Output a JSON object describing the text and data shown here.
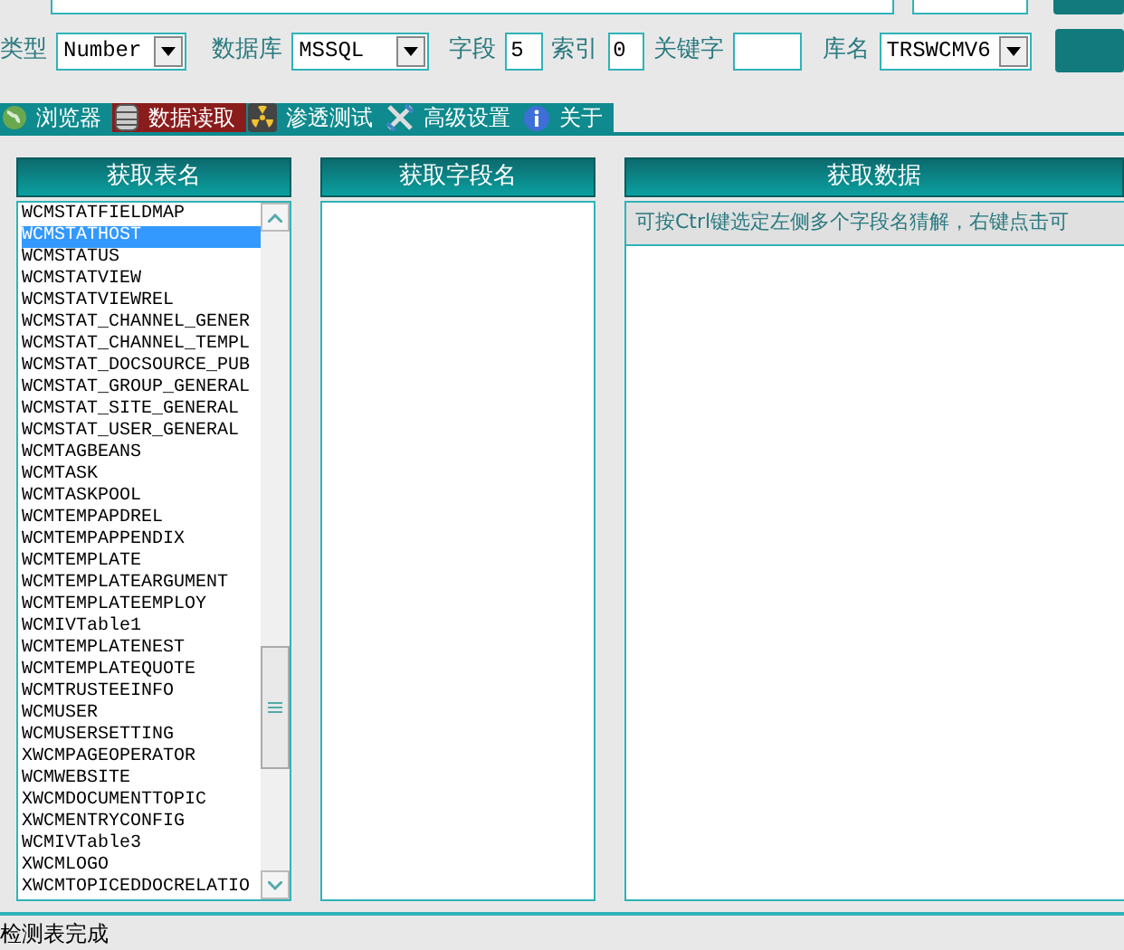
{
  "toolbar": {
    "type_label": "类型",
    "type_value": "Number",
    "db_label": "数据库",
    "db_value": "MSSQL",
    "field_label": "字段",
    "field_value": "5",
    "index_label": "索引",
    "index_value": "0",
    "keyword_label": "关键字",
    "dbname_label": "库名",
    "dbname_value": "TRSWCMV6"
  },
  "tabs": [
    {
      "label": "浏览器",
      "kind": "globe",
      "selected": false
    },
    {
      "label": "数据读取",
      "kind": "database",
      "selected": true
    },
    {
      "label": "渗透测试",
      "kind": "radiation",
      "selected": false
    },
    {
      "label": "高级设置",
      "kind": "tools",
      "selected": false
    },
    {
      "label": "关于",
      "kind": "info",
      "selected": false
    }
  ],
  "tables_panel": {
    "title": "获取表名",
    "items": [
      {
        "name": "WCMSTATFIELDMAP",
        "selected": false
      },
      {
        "name": "WCMSTATHOST",
        "selected": true
      },
      {
        "name": "WCMSTATUS",
        "selected": false
      },
      {
        "name": "WCMSTATVIEW",
        "selected": false
      },
      {
        "name": "WCMSTATVIEWREL",
        "selected": false
      },
      {
        "name": "WCMSTAT_CHANNEL_GENER",
        "selected": false
      },
      {
        "name": "WCMSTAT_CHANNEL_TEMPL",
        "selected": false
      },
      {
        "name": "WCMSTAT_DOCSOURCE_PUB",
        "selected": false
      },
      {
        "name": "WCMSTAT_GROUP_GENERAL",
        "selected": false
      },
      {
        "name": "WCMSTAT_SITE_GENERAL",
        "selected": false
      },
      {
        "name": "WCMSTAT_USER_GENERAL",
        "selected": false
      },
      {
        "name": "WCMTAGBEANS",
        "selected": false
      },
      {
        "name": "WCMTASK",
        "selected": false
      },
      {
        "name": "WCMTASKPOOL",
        "selected": false
      },
      {
        "name": "WCMTEMPAPDREL",
        "selected": false
      },
      {
        "name": "WCMTEMPAPPENDIX",
        "selected": false
      },
      {
        "name": "WCMTEMPLATE",
        "selected": false
      },
      {
        "name": "WCMTEMPLATEARGUMENT",
        "selected": false
      },
      {
        "name": "WCMTEMPLATEEMPLOY",
        "selected": false
      },
      {
        "name": "WCMIVTable1",
        "selected": false
      },
      {
        "name": "WCMTEMPLATENEST",
        "selected": false
      },
      {
        "name": "WCMTEMPLATEQUOTE",
        "selected": false
      },
      {
        "name": "WCMTRUSTEEINFO",
        "selected": false
      },
      {
        "name": "WCMUSER",
        "selected": false
      },
      {
        "name": "WCMUSERSETTING",
        "selected": false
      },
      {
        "name": "XWCMPAGEOPERATOR",
        "selected": false
      },
      {
        "name": "WCMWEBSITE",
        "selected": false
      },
      {
        "name": "XWCMDOCUMENTTOPIC",
        "selected": false
      },
      {
        "name": "XWCMENTRYCONFIG",
        "selected": false
      },
      {
        "name": "WCMIVTable3",
        "selected": false
      },
      {
        "name": "XWCMLOGO",
        "selected": false
      },
      {
        "name": "XWCMTOPICEDDOCRELATIO",
        "selected": false
      }
    ]
  },
  "fields_panel": {
    "title": "获取字段名"
  },
  "data_panel": {
    "title": "获取数据",
    "hint": "可按Ctrl键选定左侧多个字段名猜解，右键点击可"
  },
  "status_bar": "检测表完成"
}
